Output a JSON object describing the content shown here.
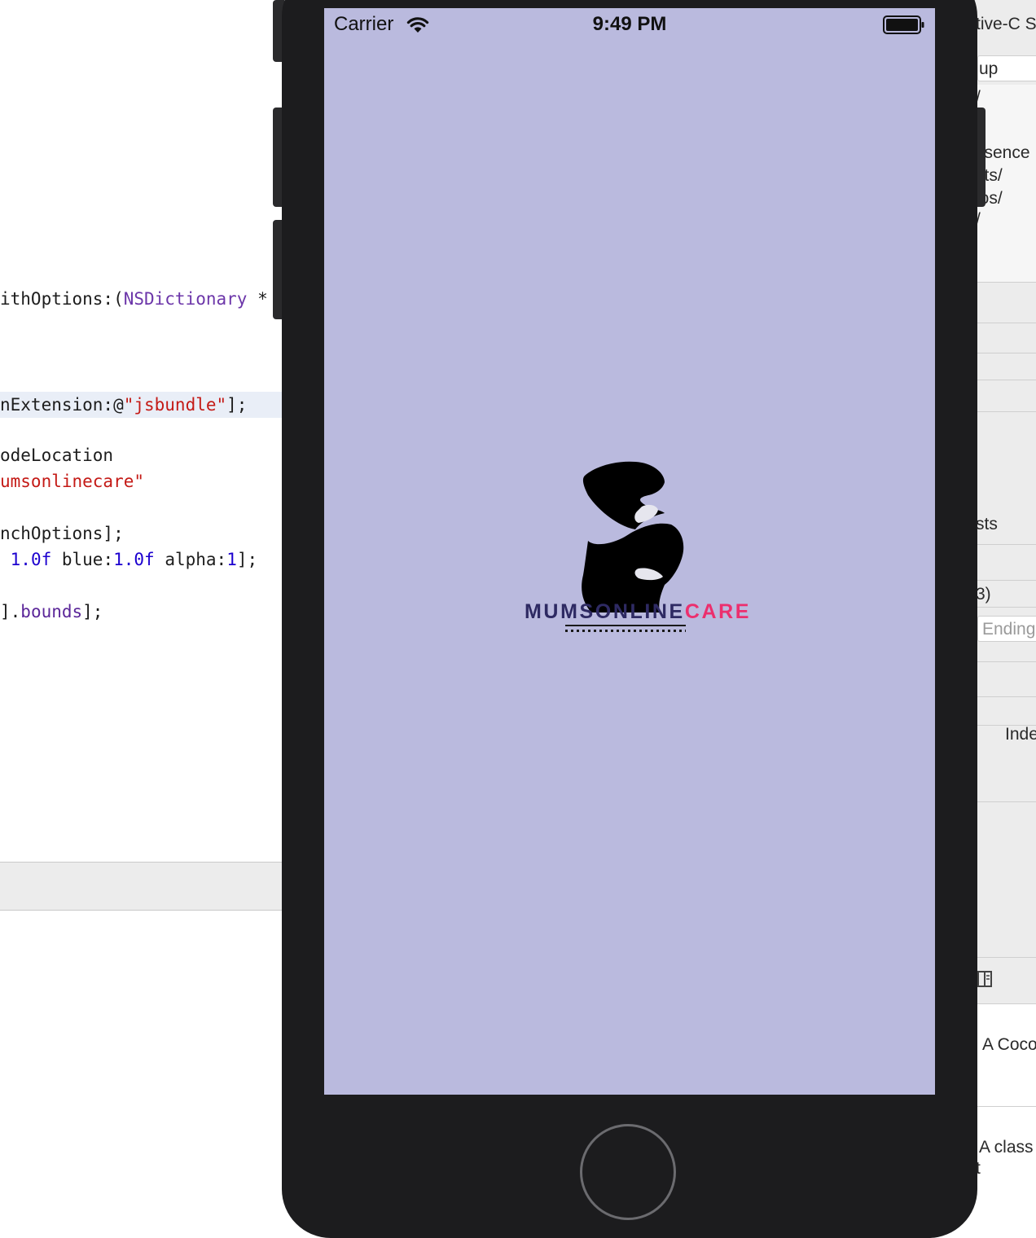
{
  "editor": {
    "lines": {
      "l1": {
        "a": "ithOptions:(",
        "b": "NSDictionary",
        "c": " *"
      },
      "l2": {
        "a": "nExtension:@",
        "b": "\"jsbundle\"",
        "c": "];"
      },
      "l3": "odeLocation",
      "l4": "umsonlinecare\"",
      "l5": "nchOptions];",
      "l6": {
        "a": " ",
        "b": "1.0f",
        "c": " blue:",
        "d": "1.0f",
        "e": " alpha:",
        "f": "1",
        "g": "];"
      },
      "l7": {
        "a": "].",
        "b": "bounds",
        "c": "];"
      }
    }
  },
  "inspector": {
    "items": [
      "tive-C S",
      "up",
      "/",
      "ssence",
      "cts/",
      "los/",
      "/",
      "sts",
      "3)",
      "Ending",
      "Inde",
      "A Coco",
      "A class",
      "t"
    ]
  },
  "simulator": {
    "status_bar": {
      "carrier": "Carrier",
      "time": "9:49 PM"
    },
    "splash": {
      "brand_part1": "MUMSONLINE",
      "brand_part2": "CARE",
      "background": "#babade",
      "brand_color_1": "#2e2a63",
      "brand_color_2": "#ec2f6e"
    }
  }
}
